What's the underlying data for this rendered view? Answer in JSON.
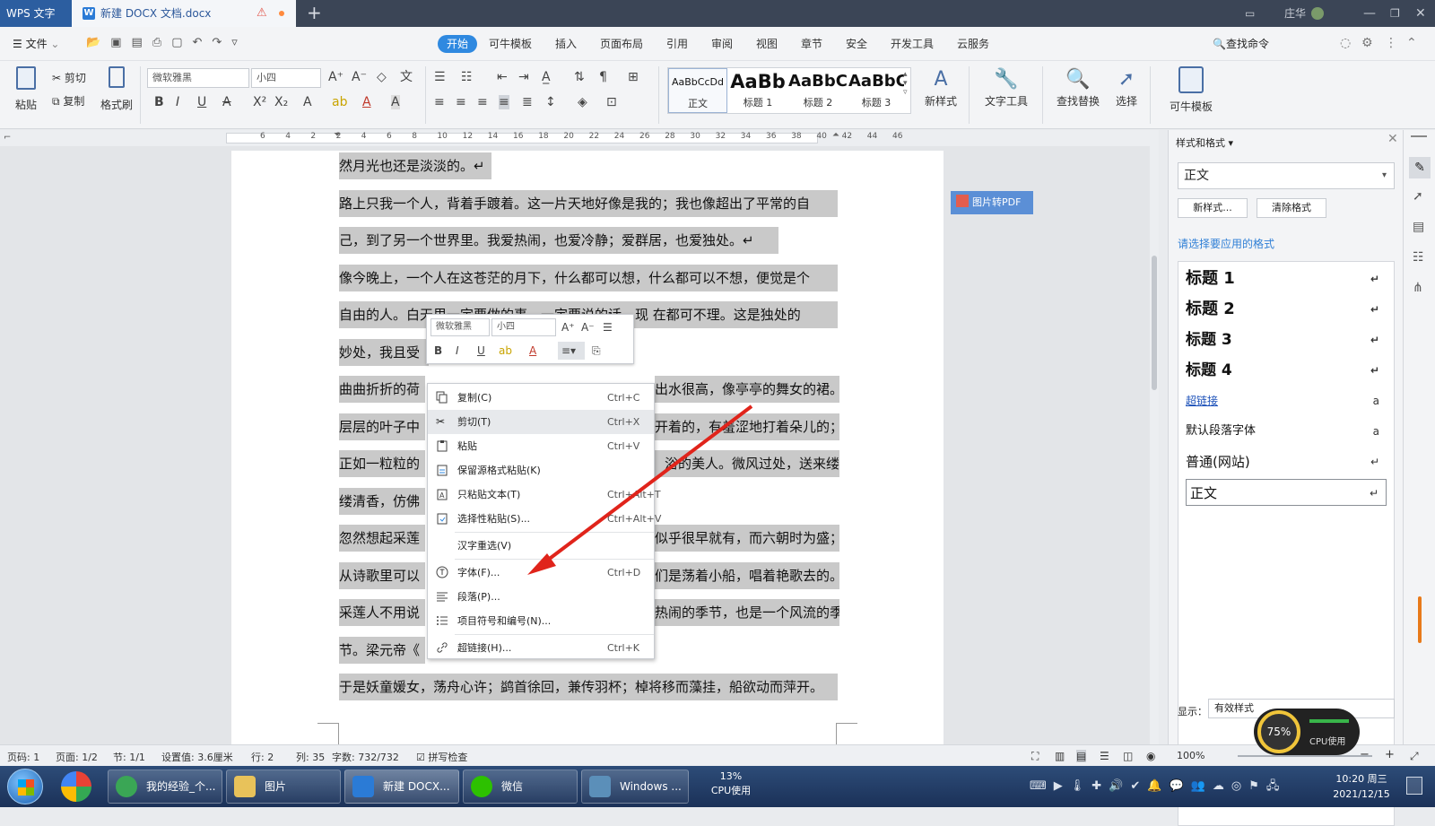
{
  "titlebar": {
    "app_name": "WPS 文字",
    "doc_tab": "新建 DOCX 文档.docx",
    "doc_icon": "W",
    "user": "庄华"
  },
  "menubar": {
    "file": "文件",
    "tabs": [
      "开始",
      "可牛模板",
      "插入",
      "页面布局",
      "引用",
      "审阅",
      "视图",
      "章节",
      "安全",
      "开发工具",
      "云服务"
    ],
    "active_tab": "开始",
    "search": "查找命令",
    "accent": "#2f89e0"
  },
  "ribbon": {
    "paste": "粘贴",
    "cut": "剪切",
    "copy": "复制",
    "format_painter": "格式刷",
    "font_name": "微软雅黑",
    "font_size": "小四",
    "styles": [
      {
        "preview": "AaBbCcDd",
        "name": "正文"
      },
      {
        "preview": "AaBb",
        "name": "标题 1"
      },
      {
        "preview": "AaBbC",
        "name": "标题 2"
      },
      {
        "preview": "AaBbC",
        "name": "标题 3"
      }
    ],
    "new_style": "新样式",
    "text_tools": "文字工具",
    "find_replace": "查找替换",
    "select": "选择",
    "kn_template": "可牛模板"
  },
  "ruler": {
    "ticks": [
      "6",
      "4",
      "2",
      "2",
      "4",
      "6",
      "8",
      "10",
      "12",
      "14",
      "16",
      "18",
      "20",
      "22",
      "24",
      "26",
      "28",
      "30",
      "32",
      "34",
      "36",
      "38",
      "40",
      "42",
      "44",
      "46"
    ]
  },
  "document": {
    "lines": [
      "然月光也还是淡淡的。↵",
      "路上只我一个人，背着手踱着。这一片天地好像是我的；我也像超出了平常的自",
      "己，到了另一个世界里。我爱热闹，也爱冷静；爱群居，也爱独处。↵",
      "像今晚上，一个人在这苍茫的月下，什么都可以想，什么都可以不想，便觉是个",
      "自由的人。白天里一定要做的事，一定要说的话，现 在都可不理。这是独处的",
      "妙处，我且受",
      "曲曲折折的荷",
      "层层的叶子中",
      "正如一粒粒的",
      "缕清香，仿佛",
      "忽然想起采莲",
      "从诗歌里可以",
      "采莲人不用说",
      "节。梁元帝《",
      "于是妖童媛女，荡舟心许；鹢首徐回，兼传羽杯；棹将移而藻挂，船欲动而萍开。"
    ],
    "right_fragments": [
      {
        "line": 6,
        "text": "出水很高，像亭亭的舞女的裙。"
      },
      {
        "line": 7,
        "text": "开着的，有羞涩地打着朵儿的；"
      },
      {
        "line": 8,
        "text": "浴的美人。微风过处，送来缕"
      },
      {
        "line": 10,
        "text": "似乎很早就有，而六朝时为盛；"
      },
      {
        "line": 11,
        "text": "们是荡着小船，唱着艳歌去的。"
      },
      {
        "line": 12,
        "text": "热闹的季节，也是一个风流的季"
      }
    ],
    "pdf_button": "图片转PDF"
  },
  "mini_toolbar": {
    "font": "微软雅黑",
    "size": "小四"
  },
  "context_menu": [
    {
      "label": "复制(C)",
      "shortcut": "Ctrl+C",
      "icon": "copy-icon"
    },
    {
      "label": "剪切(T)",
      "shortcut": "Ctrl+X",
      "icon": "scissors-icon"
    },
    {
      "label": "粘贴",
      "shortcut": "Ctrl+V",
      "icon": "paste-icon"
    },
    {
      "label": "保留源格式粘贴(K)",
      "shortcut": "",
      "icon": "paste-keep-icon"
    },
    {
      "label": "只粘贴文本(T)",
      "shortcut": "Ctrl+Alt+T",
      "icon": "paste-text-icon"
    },
    {
      "label": "选择性粘贴(S)...",
      "shortcut": "Ctrl+Alt+V",
      "icon": "paste-special-icon"
    },
    {
      "label": "汉字重选(V)",
      "shortcut": "",
      "icon": ""
    },
    {
      "label": "字体(F)...",
      "shortcut": "Ctrl+D",
      "icon": "font-icon"
    },
    {
      "label": "段落(P)...",
      "shortcut": "",
      "icon": "paragraph-icon"
    },
    {
      "label": "项目符号和编号(N)...",
      "shortcut": "",
      "icon": "bullets-icon"
    },
    {
      "label": "超链接(H)...",
      "shortcut": "Ctrl+K",
      "icon": "link-icon"
    }
  ],
  "styles_panel": {
    "title": "样式和格式",
    "current_style": "正文",
    "new_style": "新样式...",
    "clear_format": "清除格式",
    "apply_label": "请选择要应用的格式",
    "styles": [
      {
        "name": "标题 1",
        "mark": "↵"
      },
      {
        "name": "标题 2",
        "mark": "↵"
      },
      {
        "name": "标题 3",
        "mark": "↵"
      },
      {
        "name": "标题 4",
        "mark": "↵"
      },
      {
        "name": "超链接",
        "mark": "a"
      },
      {
        "name": "默认段落字体",
        "mark": "a"
      },
      {
        "name": "普通(网站)",
        "mark": "↵"
      },
      {
        "name": "正文",
        "mark": "↵"
      }
    ],
    "show_label": "显示：",
    "show_value": "有效样式"
  },
  "statusbar": {
    "page_code": "页码: 1",
    "page": "页面: 1/2",
    "section": "节: 1/1",
    "setting": "设置值: 3.6厘米",
    "row": "行: 2",
    "col": "列: 35",
    "words": "字数: 732/732",
    "spell": "拼写检查",
    "zoom": "100%"
  },
  "taskbar": {
    "items": [
      "我的经验_个...",
      "图片",
      "新建 DOCX...",
      "微信",
      "Windows ..."
    ],
    "cpu_percent": "13%",
    "cpu_label": "CPU使用",
    "time": "10:20 周三",
    "date": "2021/12/15",
    "gauge_value": "75%",
    "gauge_label": "CPU使用"
  }
}
